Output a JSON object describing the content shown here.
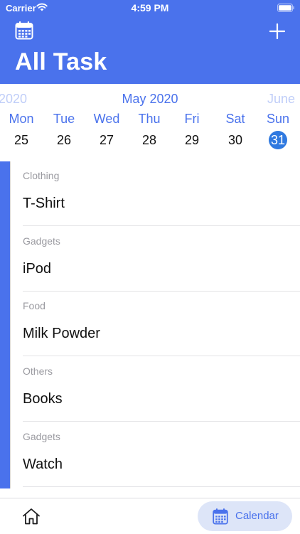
{
  "status_bar": {
    "carrier": "Carrier",
    "time": "4:59 PM",
    "wifi_icon": "wifi-icon",
    "battery_icon": "battery-icon"
  },
  "header": {
    "title": "All Task",
    "left_icon": "calendar-icon",
    "right_icon": "plus-icon",
    "background": "#4a72ec"
  },
  "calendar": {
    "prev_month": "2020",
    "current_month": "May 2020",
    "next_month": "June",
    "days": [
      {
        "dow": "Mon",
        "date": "25",
        "selected": false
      },
      {
        "dow": "Tue",
        "date": "26",
        "selected": false
      },
      {
        "dow": "Wed",
        "date": "27",
        "selected": false
      },
      {
        "dow": "Thu",
        "date": "28",
        "selected": false
      },
      {
        "dow": "Fri",
        "date": "29",
        "selected": false
      },
      {
        "dow": "Sat",
        "date": "30",
        "selected": false
      },
      {
        "dow": "Sun",
        "date": "31",
        "selected": true
      }
    ]
  },
  "tasks": [
    {
      "category": "Clothing",
      "name": "T-Shirt"
    },
    {
      "category": "Gadgets",
      "name": "iPod"
    },
    {
      "category": "Food",
      "name": "Milk Powder"
    },
    {
      "category": "Others",
      "name": "Books"
    },
    {
      "category": "Gadgets",
      "name": "Watch"
    }
  ],
  "tab_bar": {
    "home_icon": "home-icon",
    "calendar_icon": "calendar-icon",
    "calendar_label": "Calendar"
  },
  "colors": {
    "accent": "#4a72ec",
    "selected_day": "#2f79e0",
    "tab_pill": "#dde5f8"
  }
}
